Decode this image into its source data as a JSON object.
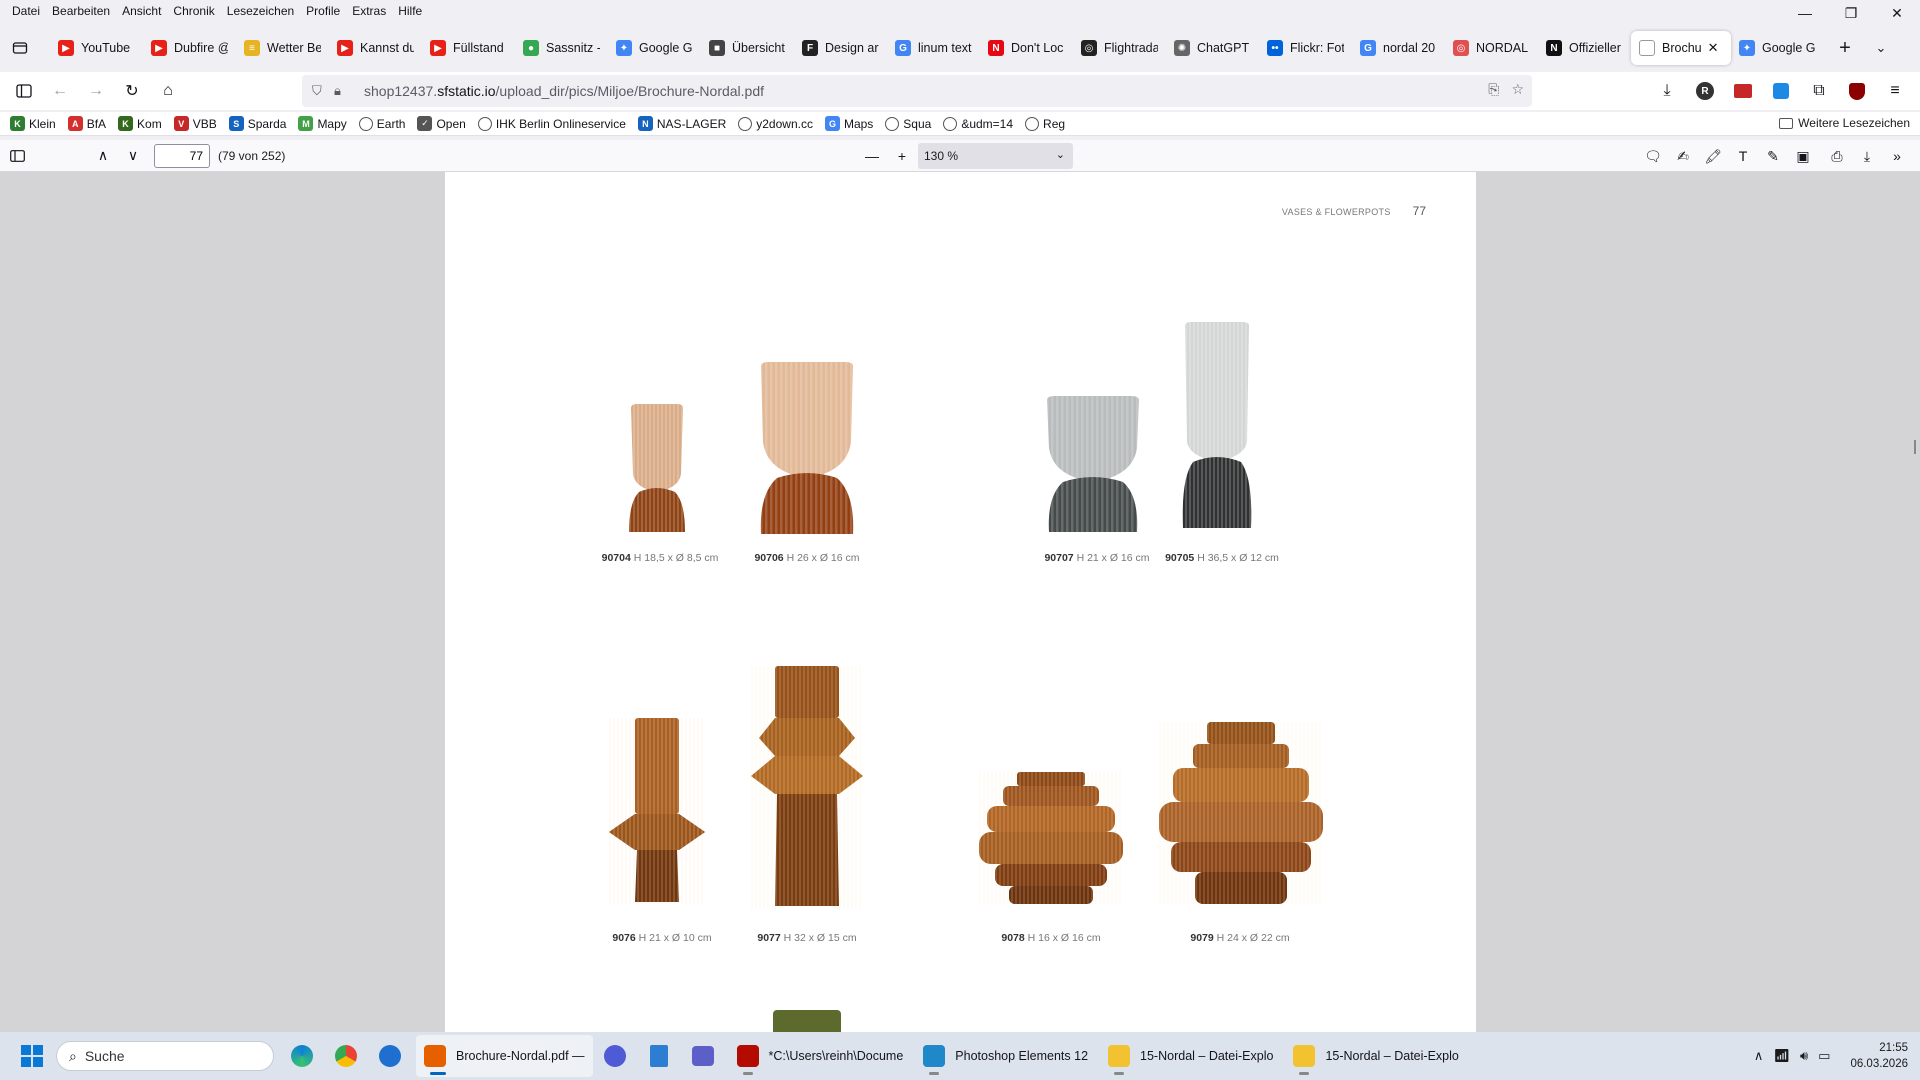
{
  "menu": [
    "Datei",
    "Bearbeiten",
    "Ansicht",
    "Chronik",
    "Lesezeichen",
    "Profile",
    "Extras",
    "Hilfe"
  ],
  "window_controls": {
    "minimize": "—",
    "restore": "❐",
    "close": "✕"
  },
  "tabs": [
    {
      "label": "YouTube",
      "icon": "youtube-icon",
      "color": "#e62117",
      "glyph": "▶"
    },
    {
      "label": "Dubfire @",
      "icon": "youtube-icon",
      "color": "#e62117",
      "glyph": "▶"
    },
    {
      "label": "Wetter Be",
      "icon": "weather-icon",
      "color": "#e6b422",
      "glyph": "≡"
    },
    {
      "label": "Kannst du",
      "icon": "youtube-icon",
      "color": "#e62117",
      "glyph": "▶"
    },
    {
      "label": "Füllstand",
      "icon": "youtube-icon",
      "color": "#e62117",
      "glyph": "▶"
    },
    {
      "label": "Sassnitz -",
      "icon": "maps-pin-icon",
      "color": "#34a853",
      "glyph": "●"
    },
    {
      "label": "Google G",
      "icon": "gemini-icon",
      "color": "#4285f4",
      "glyph": "✦"
    },
    {
      "label": "Übersicht",
      "icon": "cube-icon",
      "color": "#444444",
      "glyph": "■"
    },
    {
      "label": "Design ar",
      "icon": "font-f-icon",
      "color": "#222222",
      "glyph": "F"
    },
    {
      "label": "linum text",
      "icon": "google-icon",
      "color": "#4285f4",
      "glyph": "G"
    },
    {
      "label": "Don't Loc",
      "icon": "netflix-icon",
      "color": "#e50914",
      "glyph": "N"
    },
    {
      "label": "Flightrada",
      "icon": "radar-icon",
      "color": "#222222",
      "glyph": "◎"
    },
    {
      "label": "ChatGPT",
      "icon": "chatgpt-icon",
      "color": "#666666",
      "glyph": "✺"
    },
    {
      "label": "Flickr: Fot",
      "icon": "flickr-icon",
      "color": "#0063dc",
      "glyph": "••"
    },
    {
      "label": "nordal 20",
      "icon": "google-icon",
      "color": "#4285f4",
      "glyph": "G"
    },
    {
      "label": "NORDAL",
      "icon": "nordal-icon",
      "color": "#e05050",
      "glyph": "◎"
    },
    {
      "label": "Offizieller",
      "icon": "n-logo-icon",
      "color": "#111111",
      "glyph": "N"
    },
    {
      "label": "Brochu",
      "icon": "pdf-icon",
      "color": "#ffffff",
      "glyph": "",
      "active": true
    },
    {
      "label": "Google G",
      "icon": "gemini-icon",
      "color": "#4285f4",
      "glyph": "✦"
    }
  ],
  "url": {
    "prefix": "shop12437.",
    "domain": "sfstatic.io",
    "path": "/upload_dir/pics/Miljoe/Brochure-Nordal.pdf"
  },
  "bookmarks": [
    {
      "label": "Klein",
      "icon": "bookmark-klein-icon",
      "color": "#2e7d32",
      "glyph": "K"
    },
    {
      "label": "BfA",
      "icon": "bfa-icon",
      "color": "#d32f2f",
      "glyph": "A"
    },
    {
      "label": "Kom",
      "icon": "kom-icon",
      "color": "#33691e",
      "glyph": "K"
    },
    {
      "label": "VBB",
      "icon": "vbb-icon",
      "color": "#c62828",
      "glyph": "V"
    },
    {
      "label": "Sparda",
      "icon": "sparda-icon",
      "color": "#1565c0",
      "glyph": "S"
    },
    {
      "label": "Mapy",
      "icon": "mapy-icon",
      "color": "#43a047",
      "glyph": "M"
    },
    {
      "label": "Earth",
      "icon": "globe-icon",
      "color": "",
      "glyph": ""
    },
    {
      "label": "Open",
      "icon": "check-icon",
      "color": "#555555",
      "glyph": "✓"
    },
    {
      "label": "IHK Berlin Onlineservice",
      "icon": "globe-icon",
      "color": "",
      "glyph": ""
    },
    {
      "label": "NAS-LAGER",
      "icon": "nas-icon",
      "color": "#1565c0",
      "glyph": "N"
    },
    {
      "label": "y2down.cc",
      "icon": "globe-icon",
      "color": "",
      "glyph": ""
    },
    {
      "label": "Maps",
      "icon": "google-icon",
      "color": "#4285f4",
      "glyph": "G"
    },
    {
      "label": "Squa",
      "icon": "globe-icon",
      "color": "",
      "glyph": ""
    },
    {
      "label": "&udm=14",
      "icon": "globe-icon",
      "color": "",
      "glyph": ""
    },
    {
      "label": "Reg",
      "icon": "globe-icon",
      "color": "",
      "glyph": ""
    }
  ],
  "bookmarks_more": "Weitere Lesezeichen",
  "pdf": {
    "page_value": "77",
    "page_count": "(79 von 252)",
    "zoom": "130 %"
  },
  "page": {
    "section": "VASES & FLOWERPOTS",
    "number": "77"
  },
  "products": [
    {
      "code": "90704",
      "dims": "H 18,5 x Ø 8,5 cm",
      "color": "#c98a5e"
    },
    {
      "code": "90706",
      "dims": "H 26 x Ø 16 cm",
      "color": "#c98a5e"
    },
    {
      "code": "90707",
      "dims": "H 21 x Ø 16 cm",
      "color": "#8a8f91"
    },
    {
      "code": "90705",
      "dims": "H 36,5 x Ø 12 cm",
      "color": "#8a8f91"
    },
    {
      "code": "9076",
      "dims": "H 21 x Ø 10 cm",
      "color": "#9a5a22"
    },
    {
      "code": "9077",
      "dims": "H 32 x Ø 15 cm",
      "color": "#9a5a22"
    },
    {
      "code": "9078",
      "dims": "H 16 x Ø 16 cm",
      "color": "#9a5a22"
    },
    {
      "code": "9079",
      "dims": "H 24 x Ø 22 cm",
      "color": "#9a5a22"
    }
  ],
  "taskbar": {
    "search_placeholder": "Suche",
    "apps": [
      {
        "label": "Brochure-Nordal.pdf —",
        "icon": "firefox-icon",
        "color": "#e66000",
        "active": true
      },
      {
        "label": "*C:\\Users\\reinh\\Docume",
        "icon": "acrobat-icon",
        "color": "#b30b00"
      },
      {
        "label": "Photoshop Elements 12",
        "icon": "photoshop-elements-icon",
        "color": "#1e88c8"
      },
      {
        "label": "15-Nordal – Datei-Explo",
        "icon": "folder-icon",
        "color": "#f2c230"
      },
      {
        "label": "15-Nordal – Datei-Explo",
        "icon": "folder-icon",
        "color": "#f2c230"
      }
    ],
    "time": "21:55",
    "date": "06.03.2026"
  }
}
